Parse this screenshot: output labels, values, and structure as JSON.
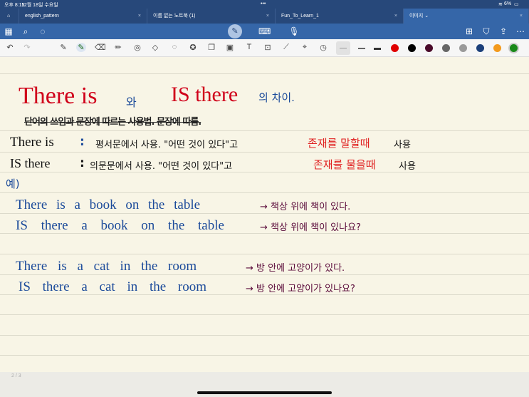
{
  "status": {
    "time": "오후 8:15",
    "date": "12월 18일 수요일",
    "battery": "6%"
  },
  "tabs": [
    {
      "label": "english_pattern"
    },
    {
      "label": "이름 없는 노트북 (1)"
    },
    {
      "label": "Fun_To_Learn_1"
    },
    {
      "label": "이미지 ⌄"
    }
  ],
  "colors": {
    "bar": "#27487a",
    "toolbar": "#3566a8",
    "palette": [
      "#e00000",
      "#000000",
      "#4a0a2a",
      "#666666",
      "#9a9a9a",
      "#1b3f7a",
      "#f39a1d",
      "#1a8a1a"
    ]
  },
  "note": {
    "title": {
      "a": "There is",
      "b": "와",
      "c": "IS there",
      "d": "의 차이."
    },
    "scribble": "단어의 쓰임과 문장에 따르는 사용법. 문장에 따름.",
    "rows": [
      {
        "head": "There is",
        "colon": ":",
        "body": "평서문에서 사용. \"어떤 것이 있다\"고",
        "red": "존재를 말할때",
        "tail": "사용"
      },
      {
        "head": "IS there",
        "colon": ":",
        "body": "의문문에서 사용. \"어떤 것이 있다\"고",
        "red": "존재를 물을때",
        "tail": "사용"
      }
    ],
    "example": "예)",
    "examples": [
      {
        "en": "There is a book on the table",
        "ko": "→ 책상 위에 책이 있다."
      },
      {
        "en": "IS there a book on the table",
        "ko": "→ 책상 위에 책이 있나요?"
      },
      {
        "en": "There is a cat in the room",
        "ko": "→ 방 안에 고양이가 있다."
      },
      {
        "en": "IS there a cat in the room",
        "ko": "→ 방 안에 고양이가 있나요?"
      }
    ]
  },
  "page_number": "2 / 3"
}
